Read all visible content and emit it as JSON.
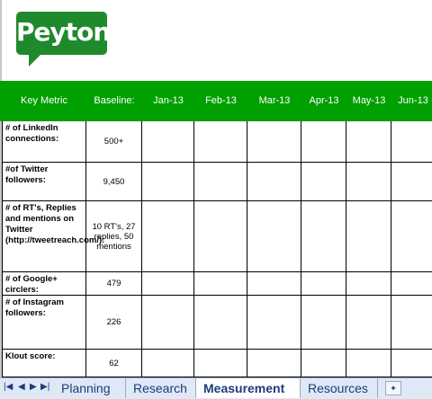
{
  "logo": {
    "text": "Peyton"
  },
  "header": {
    "key_metric": "Key Metric",
    "baseline": "Baseline:",
    "months": [
      "Jan-13",
      "Feb-13",
      "Mar-13",
      "Apr-13",
      "May-13",
      "Jun-13"
    ]
  },
  "rows": [
    {
      "metric": "# of LinkedIn connections:",
      "baseline": "500+"
    },
    {
      "metric": "#of Twitter followers:",
      "baseline": "9,450"
    },
    {
      "metric": "# of RT's, Replies and mentions on Twitter (http://tweetreach.com/):",
      "baseline": "10 RT's, 27 replies, 50 mentions"
    },
    {
      "metric": "# of Google+ circlers:",
      "baseline": "479"
    },
    {
      "metric": "# of Instagram followers:",
      "baseline": "226"
    },
    {
      "metric": "Klout score:",
      "baseline": "62"
    }
  ],
  "tabs": {
    "nav": [
      "|◀",
      "◀",
      "▶",
      "▶|"
    ],
    "sheets": [
      "Planning",
      "Research",
      "Measurement",
      "Resources"
    ],
    "active": "Measurement",
    "new_sheet_icon": "new-sheet-icon"
  },
  "colors": {
    "header_green": "#00a000",
    "logo_green": "#1f8a2c"
  }
}
